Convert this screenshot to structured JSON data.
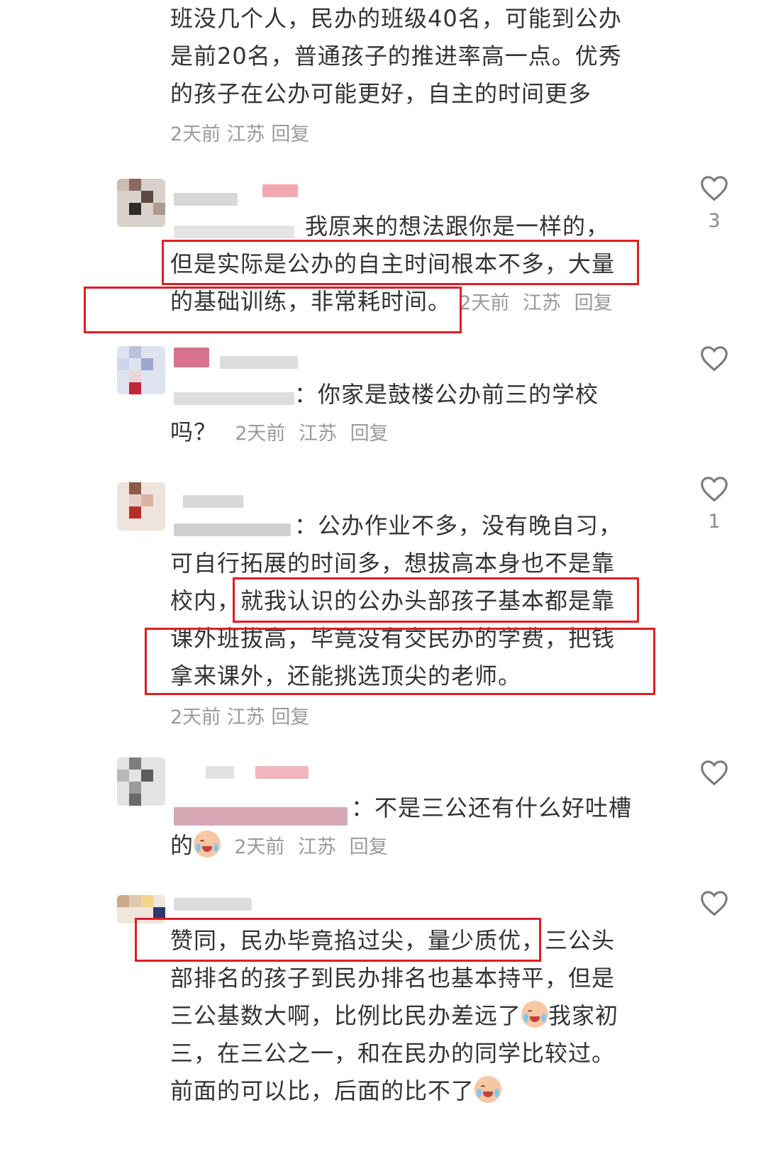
{
  "comments": [
    {
      "lines": [
        "班没几个人，民办的班级40名，可能到公办",
        "是前20名，普通孩子的推进率高一点。优秀",
        "的孩子在公办可能更好，自主的时间更多"
      ],
      "meta": {
        "time": "2天前",
        "location": "江苏",
        "reply": "回复"
      }
    },
    {
      "lines": [
        "我原来的想法跟你是一样的，",
        "但是实际是公办的自主时间根本不多，大量",
        "的基础训练，非常耗时间。"
      ],
      "meta": {
        "time": "2天前",
        "location": "江苏",
        "reply": "回复"
      },
      "likes": "3"
    },
    {
      "lines": [
        "：你家是鼓楼公办前三的学校",
        "吗？"
      ],
      "meta": {
        "time": "2天前",
        "location": "江苏",
        "reply": "回复"
      }
    },
    {
      "lines": [
        "：公办作业不多，没有晚自习，",
        "可自行拓展的时间多，想拔高本身也不是靠",
        "校内，就我认识的公办头部孩子基本都是靠",
        "课外班拔高，毕竟没有交民办的学费，把钱",
        "拿来课外，还能挑选顶尖的老师。"
      ],
      "meta": {
        "time": "2天前",
        "location": "江苏",
        "reply": "回复"
      },
      "likes": "1"
    },
    {
      "lines": [
        "：不是三公还有什么好吐槽",
        "的"
      ],
      "meta": {
        "time": "2天前",
        "location": "江苏",
        "reply": "回复"
      }
    },
    {
      "lines": [
        "赞同，民办毕竟掐过尖，量少质优，三公头",
        "部排名的孩子到民办排名也基本持平，但是",
        "三公基数大啊，比例比民办差远了",
        "我家初",
        "三，在三公之一，和在民办的同学比较过。",
        "前面的可以比，后面的比不了"
      ]
    }
  ],
  "icons": {
    "like": "heart-outline-icon",
    "emoji": "crying-face-emoji"
  },
  "colors": {
    "highlight": "#e01e24",
    "meta": "#9a9a9a",
    "text": "#333333"
  }
}
